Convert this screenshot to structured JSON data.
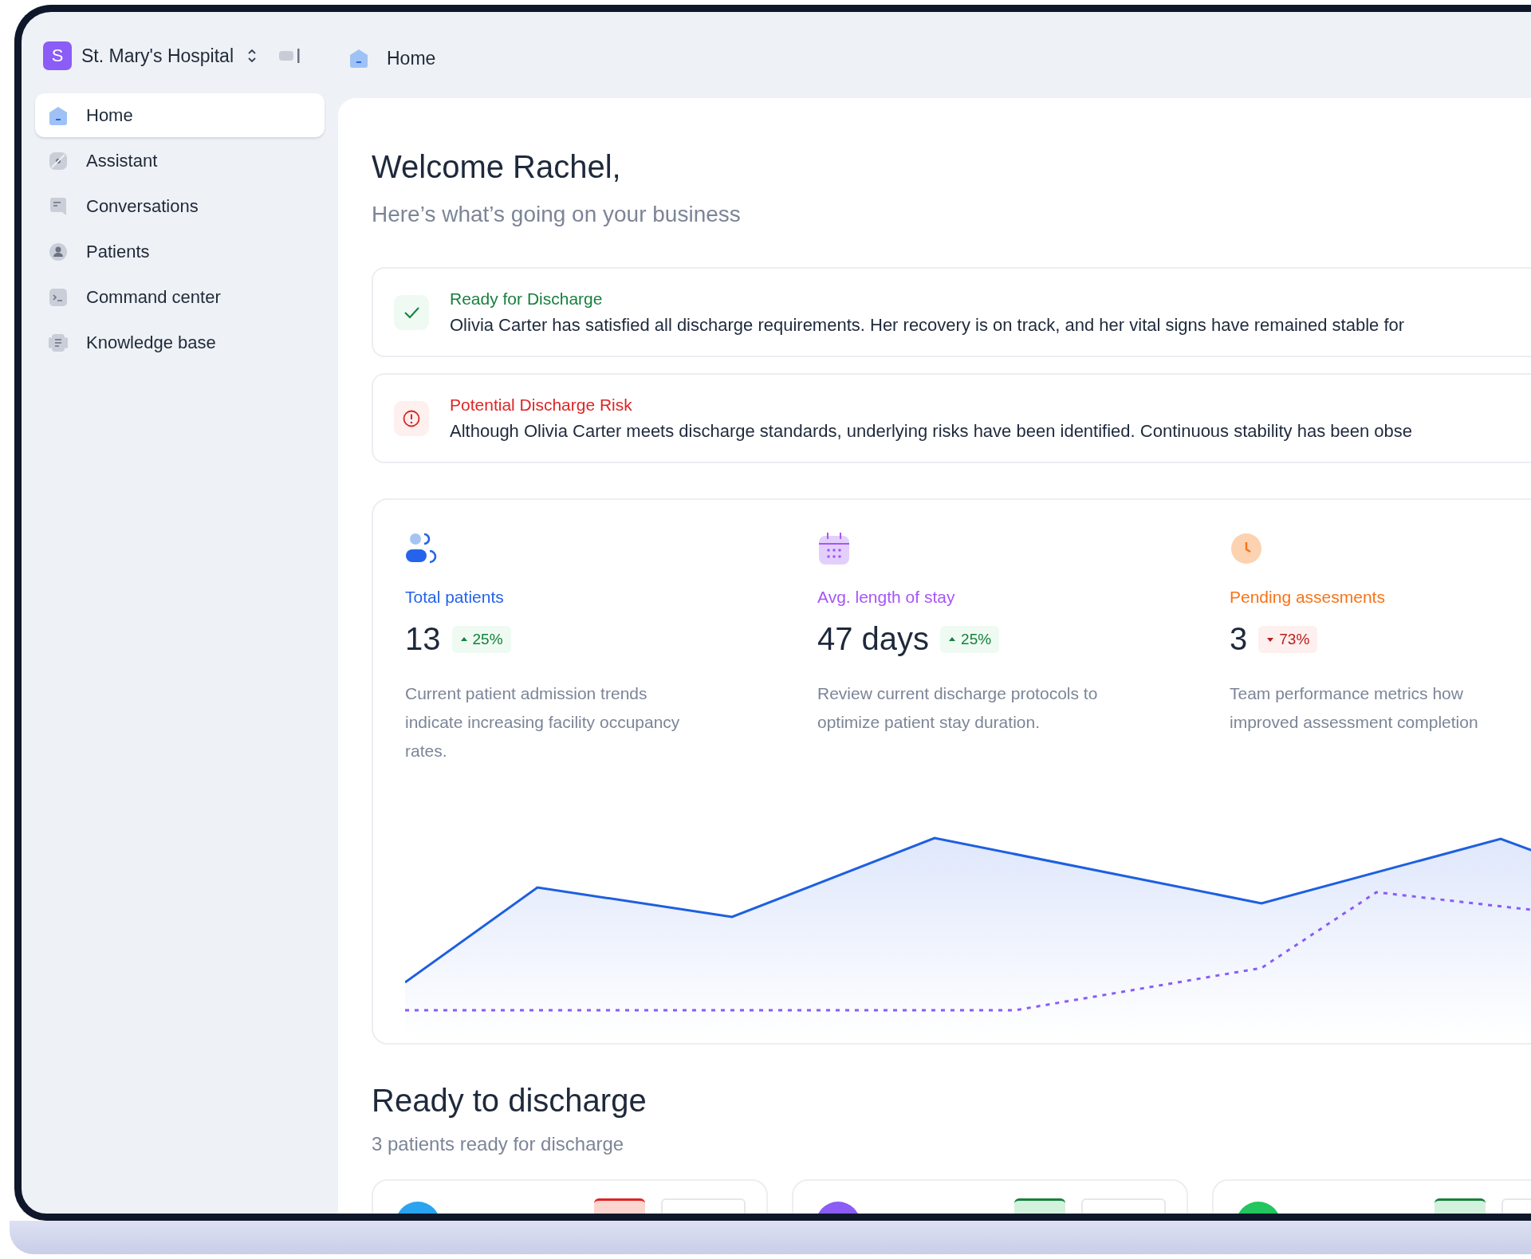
{
  "sidebar": {
    "organization": {
      "initial": "S",
      "name": "St. Mary's Hospital"
    },
    "items": [
      {
        "label": "Home",
        "selected": true
      },
      {
        "label": "Assistant",
        "selected": false
      },
      {
        "label": "Conversations",
        "selected": false
      },
      {
        "label": "Patients",
        "selected": false
      },
      {
        "label": "Command center",
        "selected": false
      },
      {
        "label": "Knowledge base",
        "selected": false
      }
    ]
  },
  "breadcrumb": {
    "label": "Home"
  },
  "main": {
    "title": "Welcome Rachel,",
    "subtitle": "Here’s what’s going on your business",
    "alerts": [
      {
        "kind": "success",
        "title": "Ready for Discharge",
        "message": "Olivia Carter has satisfied all discharge requirements. Her recovery is on track, and her vital signs have remained stable for"
      },
      {
        "kind": "risk",
        "title": "Potential Discharge Risk",
        "message": "Although Olivia Carter meets discharge standards, underlying risks have been identified. Continuous stability has been obse"
      }
    ],
    "stats": [
      {
        "label": "Total patients",
        "color": "#2563eb",
        "value": "13",
        "change": "25%",
        "negative": false,
        "description": "Current patient admission trends indicate increasing facility occupancy rates."
      },
      {
        "label": "Avg. length of stay",
        "color": "#a855f7",
        "value": "47 days",
        "change": "25%",
        "negative": false,
        "description": "Review current discharge protocols to optimize patient stay duration."
      },
      {
        "label": "Pending assesments",
        "color": "#f97316",
        "value": "3",
        "change": "73%",
        "negative": true,
        "description": "Team performance metrics how improved assessment completion"
      }
    ],
    "discharge": {
      "title": "Ready to discharge",
      "subtitle": "3 patients ready for discharge",
      "patients": [
        {
          "color": "#2aa3f0",
          "at_risk": true
        },
        {
          "color": "#8b5cf6",
          "at_risk": false
        },
        {
          "color": "#22c55e",
          "at_risk": false
        }
      ]
    }
  }
}
